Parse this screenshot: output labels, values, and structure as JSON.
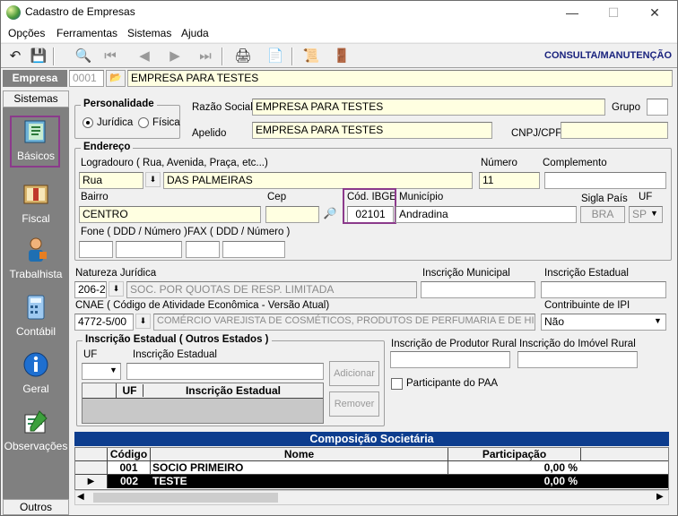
{
  "window": {
    "title": "Cadastro de Empresas"
  },
  "menu": [
    "Opções",
    "Ferramentas",
    "Sistemas",
    "Ajuda"
  ],
  "mode_label": "CONSULTA/MANUTENÇÃO",
  "empresa": {
    "label": "Empresa",
    "code": "0001",
    "name": "EMPRESA PARA TESTES"
  },
  "sidebar": {
    "header": "Sistemas",
    "footer": "Outros",
    "items": [
      {
        "label": "Básicos",
        "icon": "book-icon"
      },
      {
        "label": "Fiscal",
        "icon": "ledger-icon"
      },
      {
        "label": "Trabalhista",
        "icon": "worker-icon"
      },
      {
        "label": "Contábil",
        "icon": "calculator-icon"
      },
      {
        "label": "Geral",
        "icon": "info-icon"
      },
      {
        "label": "Observações",
        "icon": "notepad-icon"
      }
    ]
  },
  "personalidade": {
    "title": "Personalidade",
    "juridica": "Jurídica",
    "fisica": "Física",
    "selected": "Jurídica"
  },
  "razao_social": {
    "label": "Razão Social",
    "value": "EMPRESA PARA TESTES"
  },
  "apelido": {
    "label": "Apelido",
    "value": "EMPRESA PARA TESTES"
  },
  "grupo": {
    "label": "Grupo",
    "value": ""
  },
  "cnpj": {
    "label": "CNPJ/CPF",
    "value": ""
  },
  "endereco": {
    "title": "Endereço",
    "logradouro_label": "Logradouro ( Rua, Avenida, Praça, etc...)",
    "tipo": "Rua",
    "logradouro": "DAS PALMEIRAS",
    "numero_label": "Número",
    "numero": "11",
    "complemento_label": "Complemento",
    "complemento": "",
    "bairro_label": "Bairro",
    "bairro": "CENTRO",
    "cep_label": "Cep",
    "cep": "",
    "ibge_label": "Cód. IBGE",
    "ibge": "02101",
    "municipio_label": "Município",
    "municipio": "Andradina",
    "pais_label": "Sigla País",
    "pais": "BRA",
    "uf_label": "UF",
    "uf": "SP",
    "fone_label": "Fone ( DDD / Número )",
    "fax_label": "FAX ( DDD / Número )"
  },
  "natureza": {
    "label": "Natureza Jurídica",
    "code": "206-2",
    "desc": "SOC. POR QUOTAS DE RESP. LIMITADA"
  },
  "insc_municipal": {
    "label": "Inscrição Municipal",
    "value": ""
  },
  "insc_estadual": {
    "label": "Inscrição Estadual",
    "value": ""
  },
  "cnae": {
    "label": "CNAE ( Código de Atividade Econômica - Versão Atual)",
    "code": "4772-5/00",
    "desc": "COMÉRCIO VAREJISTA DE COSMÉTICOS, PRODUTOS DE PERFUMARIA E DE HIGIENE PESSOAL"
  },
  "ipi": {
    "label": "Contribuinte de IPI",
    "value": "Não"
  },
  "outros_estados": {
    "title": "Inscrição Estadual ( Outros Estados )",
    "uf_label": "UF",
    "ie_label": "Inscrição Estadual",
    "add": "Adicionar",
    "remove": "Remover",
    "col_uf": "UF",
    "col_ie": "Inscrição Estadual"
  },
  "produtor_rural": {
    "label": "Inscrição de Produtor Rural",
    "value": ""
  },
  "imovel_rural": {
    "label": "Inscrição do Imóvel Rural",
    "value": ""
  },
  "paa": {
    "label": "Participante do PAA",
    "checked": false
  },
  "societaria": {
    "title": "Composição Societária",
    "columns": [
      "Código",
      "Nome",
      "Participação"
    ],
    "rows": [
      {
        "codigo": "001",
        "nome": "SOCIO PRIMEIRO",
        "part": "0,00 %"
      },
      {
        "codigo": "002",
        "nome": "TESTE",
        "part": "0,00 %"
      }
    ]
  }
}
